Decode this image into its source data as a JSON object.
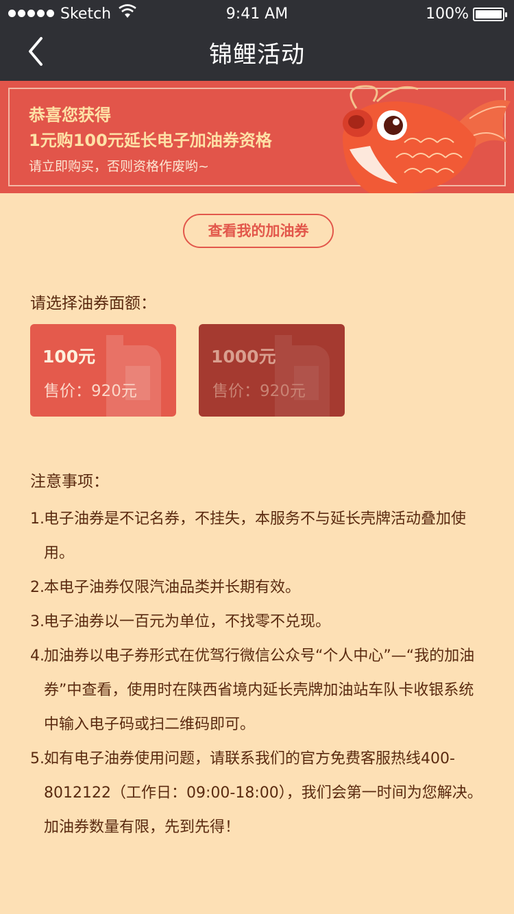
{
  "status_bar": {
    "carrier": "Sketch",
    "time": "9:41 AM",
    "battery": "100%"
  },
  "nav": {
    "title": "锦鲤活动",
    "back_icon": "chevron-left-icon"
  },
  "banner": {
    "line1": "恭喜您获得",
    "line2": "1元购100元延长电子加油券资格",
    "line3": "请立即购买，否则资格作废哟~",
    "image": "koi-fish-illustration"
  },
  "check_button": "查看我的加油券",
  "select_label": "请选择油券面额：",
  "cards": [
    {
      "amount": "100元",
      "price": "售价：920元"
    },
    {
      "amount": "1000元",
      "price": "售价：920元"
    }
  ],
  "notes": {
    "title": "注意事项：",
    "items": [
      {
        "num": "1.",
        "text": "电子油券是不记名券，不挂失，本服务不与延长壳牌活动叠加使用。"
      },
      {
        "num": "2.",
        "text": "本电子油券仅限汽油品类并长期有效。"
      },
      {
        "num": "3.",
        "text": "电子油券以一百元为单位，不找零不兑现。"
      },
      {
        "num": "4.",
        "text": "加油券以电子券形式在优驾行微信公众号“个人中心”—“我的加油券”中查看，使用时在陕西省境内延长壳牌加油站车队卡收银系统中输入电子码或扫二维码即可。"
      },
      {
        "num": "5.",
        "text": "如有电子油券使用问题，请联系我们的官方免费客服热线400-8012122（工作日：09:00-18:00），我们会第一时间为您解决。加油券数量有限，先到先得！"
      }
    ]
  },
  "colors": {
    "nav_bg": "#2f3035",
    "page_bg": "#fde0b5",
    "accent": "#e2554a",
    "text": "#5a2a10"
  }
}
